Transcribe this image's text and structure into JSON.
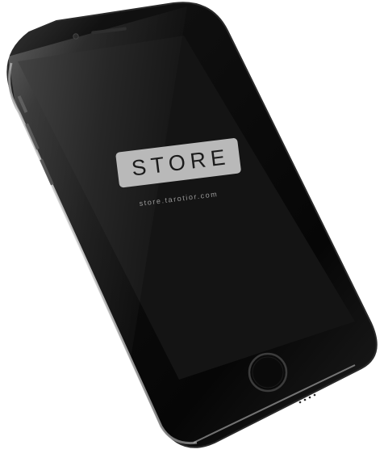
{
  "logo": {
    "title": "STORE",
    "subtitle": "store.tarotior.com"
  },
  "icons": {
    "camera": "front-camera-icon",
    "speaker": "earpiece-speaker-icon",
    "home": "home-button-icon"
  },
  "colors": {
    "body": "#0b0b0b",
    "screen": "#141414",
    "badge": "#b9b9b9",
    "badge_text": "#1b1b1b"
  }
}
